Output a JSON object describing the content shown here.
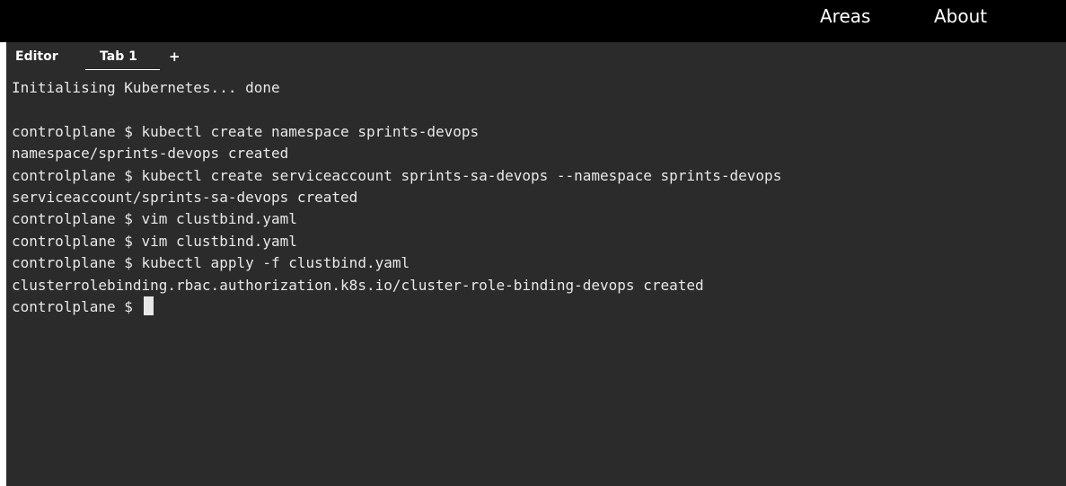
{
  "nav": {
    "areas_label": "Areas",
    "about_label": "About"
  },
  "tabs": {
    "editor_label": "Editor",
    "tab1_label": "Tab 1",
    "add_label": "+"
  },
  "terminal": {
    "lines": [
      "Initialising Kubernetes... done",
      "",
      "controlplane $ kubectl create namespace sprints-devops",
      "namespace/sprints-devops created",
      "controlplane $ kubectl create serviceaccount sprints-sa-devops --namespace sprints-devops",
      "serviceaccount/sprints-sa-devops created",
      "controlplane $ vim clustbind.yaml",
      "controlplane $ vim clustbind.yaml",
      "controlplane $ kubectl apply -f clustbind.yaml",
      "clusterrolebinding.rbac.authorization.k8s.io/cluster-role-binding-devops created"
    ],
    "prompt": "controlplane $ "
  },
  "colors": {
    "terminal_background": "#2b2b2b",
    "terminal_text": "#e8e8e8",
    "topbar_background": "#000000"
  }
}
